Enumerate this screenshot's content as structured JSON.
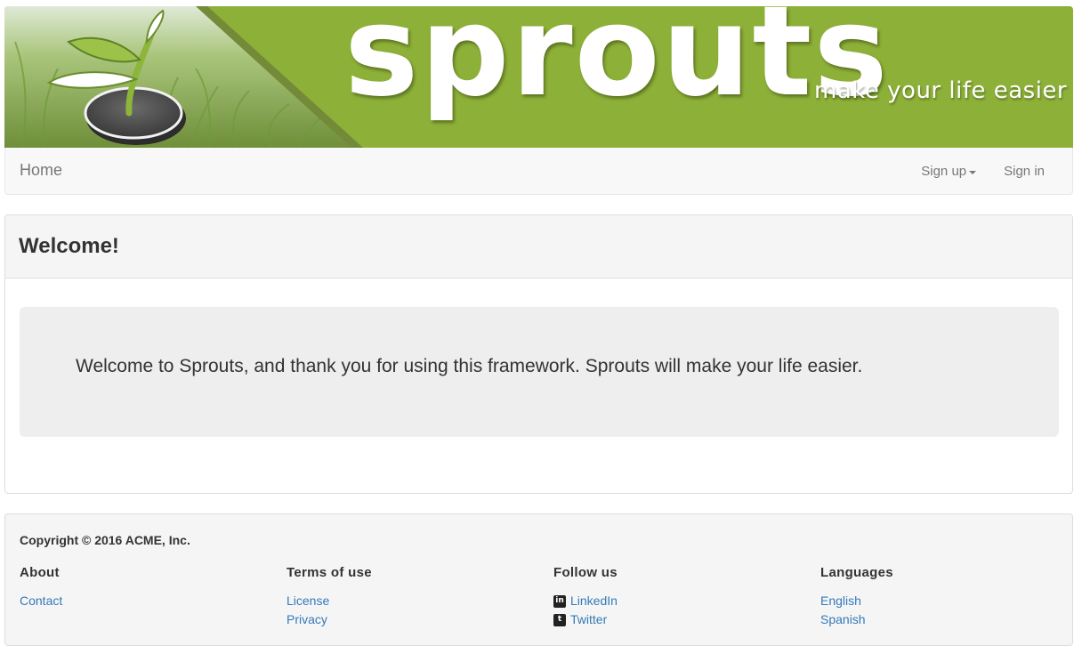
{
  "brand": {
    "name": "sprouts",
    "tagline": "make your life easier",
    "colors": {
      "banner_green": "#8db038",
      "field_green": "#a8c87a"
    }
  },
  "nav": {
    "home_label": "Home",
    "signup_label": "Sign up",
    "signin_label": "Sign in"
  },
  "welcome": {
    "heading": "Welcome!",
    "message": "Welcome to Sprouts, and thank you for using this framework. Sprouts will make your life easier."
  },
  "footer": {
    "copyright": "Copyright © 2016 ACME, Inc.",
    "about": {
      "heading": "About",
      "links": [
        "Contact"
      ]
    },
    "terms": {
      "heading": "Terms of use",
      "links": [
        "License",
        "Privacy"
      ]
    },
    "follow": {
      "heading": "Follow us",
      "links": [
        {
          "label": "LinkedIn",
          "icon": "linkedin-icon",
          "glyph": "in"
        },
        {
          "label": "Twitter",
          "icon": "twitter-icon",
          "glyph": "t"
        }
      ]
    },
    "languages": {
      "heading": "Languages",
      "links": [
        "English",
        "Spanish"
      ]
    },
    "link_color": "#337ab7"
  }
}
